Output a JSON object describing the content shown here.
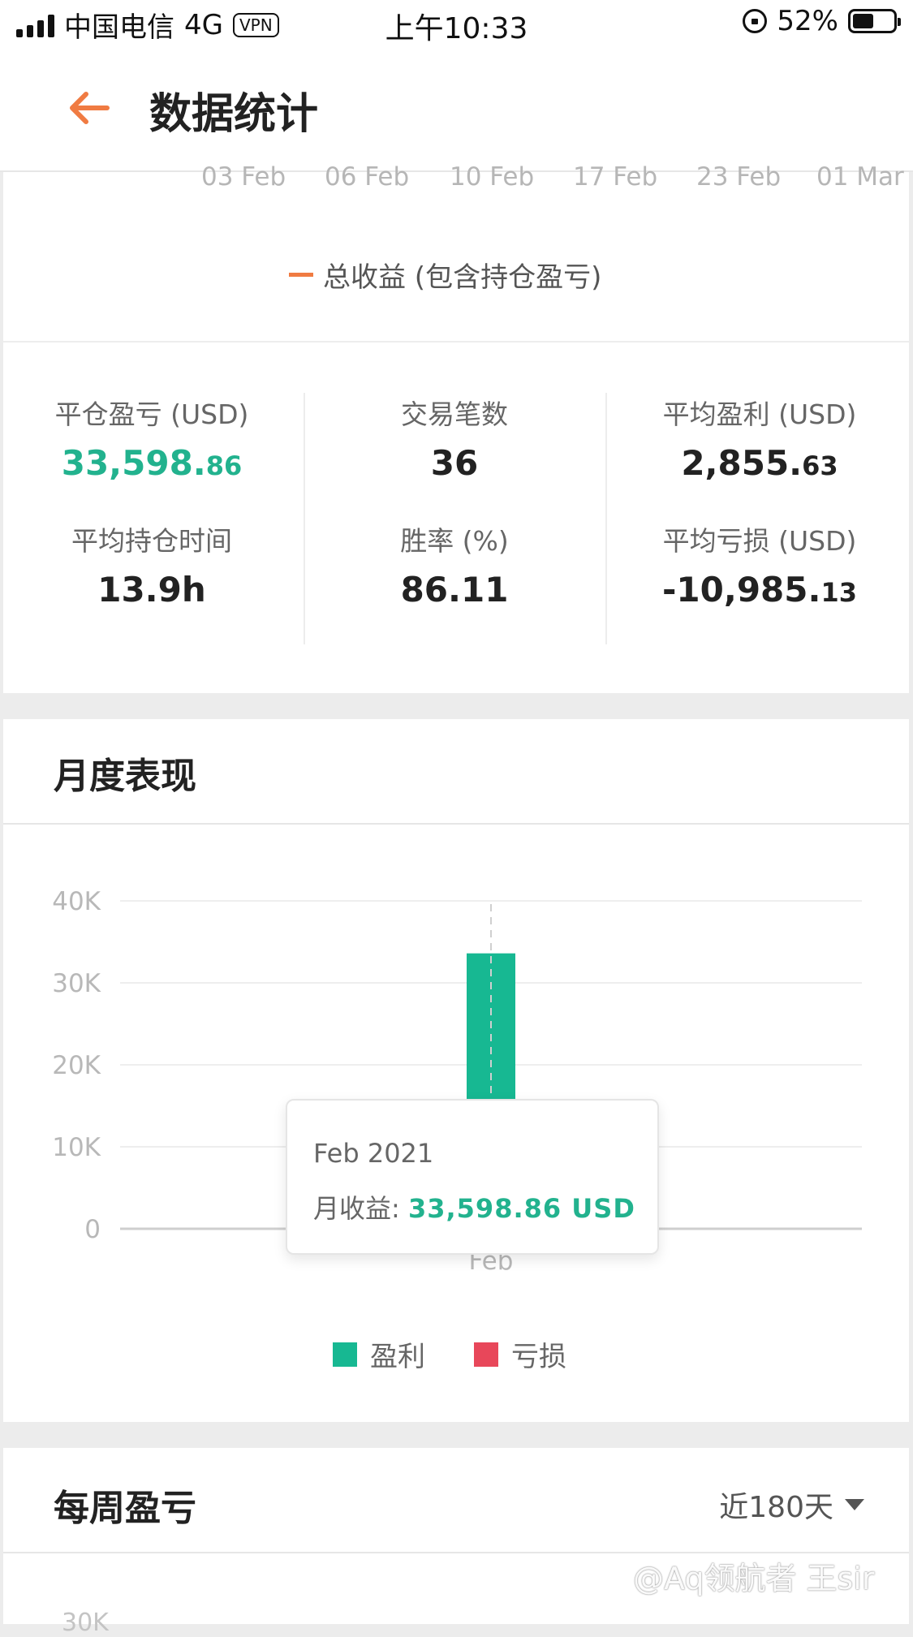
{
  "status_bar": {
    "carrier": "中国电信",
    "network": "4G",
    "vpn": "VPN",
    "time": "上午10:33",
    "battery": "52%",
    "battery_level": 0.52
  },
  "header": {
    "title": "数据统计",
    "back_icon": "arrow-left-icon",
    "accent_color": "#f07b42"
  },
  "top_chart": {
    "x_ticks": [
      "03 Feb",
      "06 Feb",
      "10 Feb",
      "17 Feb",
      "23 Feb",
      "01 Mar"
    ],
    "legend": "总收益 (包含持仓盈亏)",
    "line_color": "#f07b42"
  },
  "stats": {
    "closed_pnl": {
      "label": "平仓盈亏 (USD)",
      "int": "33,598.",
      "dec": "86"
    },
    "trade_count": {
      "label": "交易笔数",
      "value": "36"
    },
    "avg_profit": {
      "label": "平均盈利 (USD)",
      "int": "2,855.",
      "dec": "63"
    },
    "avg_hold": {
      "label": "平均持仓时间",
      "value": "13.9h"
    },
    "win_rate": {
      "label": "胜率 (%)",
      "value": "86.11"
    },
    "avg_loss": {
      "label": "平均亏损 (USD)",
      "int": "-10,985.",
      "dec": "13"
    }
  },
  "monthly": {
    "title": "月度表现",
    "tooltip": {
      "title": "Feb 2021",
      "label": "月收益: ",
      "value": "33,598.86 USD"
    },
    "legend": {
      "profit": "盈利",
      "loss": "亏损"
    }
  },
  "chart_data": {
    "type": "bar",
    "categories": [
      "Feb"
    ],
    "series": [
      {
        "name": "盈利",
        "values": [
          33598.86
        ],
        "color": "#17b892"
      },
      {
        "name": "亏损",
        "values": [
          0
        ],
        "color": "#e8475a"
      }
    ],
    "y_ticks": [
      "0",
      "10K",
      "20K",
      "30K",
      "40K"
    ],
    "ylim": [
      0,
      40000
    ],
    "grid": true,
    "legend_position": "bottom"
  },
  "weekly": {
    "title": "每周盈亏",
    "range": "近180天",
    "peek_tick": "30K"
  },
  "watermark": "@Aq领航者 王sir"
}
